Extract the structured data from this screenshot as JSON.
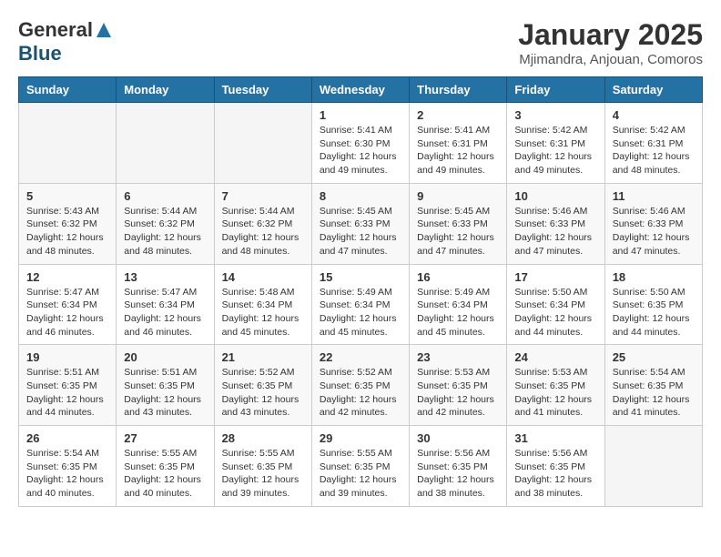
{
  "header": {
    "logo_general": "General",
    "logo_blue": "Blue",
    "month_title": "January 2025",
    "subtitle": "Mjimandra, Anjouan, Comoros"
  },
  "weekdays": [
    "Sunday",
    "Monday",
    "Tuesday",
    "Wednesday",
    "Thursday",
    "Friday",
    "Saturday"
  ],
  "weeks": [
    [
      {
        "day": "",
        "info": ""
      },
      {
        "day": "",
        "info": ""
      },
      {
        "day": "",
        "info": ""
      },
      {
        "day": "1",
        "info": "Sunrise: 5:41 AM\nSunset: 6:30 PM\nDaylight: 12 hours\nand 49 minutes."
      },
      {
        "day": "2",
        "info": "Sunrise: 5:41 AM\nSunset: 6:31 PM\nDaylight: 12 hours\nand 49 minutes."
      },
      {
        "day": "3",
        "info": "Sunrise: 5:42 AM\nSunset: 6:31 PM\nDaylight: 12 hours\nand 49 minutes."
      },
      {
        "day": "4",
        "info": "Sunrise: 5:42 AM\nSunset: 6:31 PM\nDaylight: 12 hours\nand 48 minutes."
      }
    ],
    [
      {
        "day": "5",
        "info": "Sunrise: 5:43 AM\nSunset: 6:32 PM\nDaylight: 12 hours\nand 48 minutes."
      },
      {
        "day": "6",
        "info": "Sunrise: 5:44 AM\nSunset: 6:32 PM\nDaylight: 12 hours\nand 48 minutes."
      },
      {
        "day": "7",
        "info": "Sunrise: 5:44 AM\nSunset: 6:32 PM\nDaylight: 12 hours\nand 48 minutes."
      },
      {
        "day": "8",
        "info": "Sunrise: 5:45 AM\nSunset: 6:33 PM\nDaylight: 12 hours\nand 47 minutes."
      },
      {
        "day": "9",
        "info": "Sunrise: 5:45 AM\nSunset: 6:33 PM\nDaylight: 12 hours\nand 47 minutes."
      },
      {
        "day": "10",
        "info": "Sunrise: 5:46 AM\nSunset: 6:33 PM\nDaylight: 12 hours\nand 47 minutes."
      },
      {
        "day": "11",
        "info": "Sunrise: 5:46 AM\nSunset: 6:33 PM\nDaylight: 12 hours\nand 47 minutes."
      }
    ],
    [
      {
        "day": "12",
        "info": "Sunrise: 5:47 AM\nSunset: 6:34 PM\nDaylight: 12 hours\nand 46 minutes."
      },
      {
        "day": "13",
        "info": "Sunrise: 5:47 AM\nSunset: 6:34 PM\nDaylight: 12 hours\nand 46 minutes."
      },
      {
        "day": "14",
        "info": "Sunrise: 5:48 AM\nSunset: 6:34 PM\nDaylight: 12 hours\nand 45 minutes."
      },
      {
        "day": "15",
        "info": "Sunrise: 5:49 AM\nSunset: 6:34 PM\nDaylight: 12 hours\nand 45 minutes."
      },
      {
        "day": "16",
        "info": "Sunrise: 5:49 AM\nSunset: 6:34 PM\nDaylight: 12 hours\nand 45 minutes."
      },
      {
        "day": "17",
        "info": "Sunrise: 5:50 AM\nSunset: 6:34 PM\nDaylight: 12 hours\nand 44 minutes."
      },
      {
        "day": "18",
        "info": "Sunrise: 5:50 AM\nSunset: 6:35 PM\nDaylight: 12 hours\nand 44 minutes."
      }
    ],
    [
      {
        "day": "19",
        "info": "Sunrise: 5:51 AM\nSunset: 6:35 PM\nDaylight: 12 hours\nand 44 minutes."
      },
      {
        "day": "20",
        "info": "Sunrise: 5:51 AM\nSunset: 6:35 PM\nDaylight: 12 hours\nand 43 minutes."
      },
      {
        "day": "21",
        "info": "Sunrise: 5:52 AM\nSunset: 6:35 PM\nDaylight: 12 hours\nand 43 minutes."
      },
      {
        "day": "22",
        "info": "Sunrise: 5:52 AM\nSunset: 6:35 PM\nDaylight: 12 hours\nand 42 minutes."
      },
      {
        "day": "23",
        "info": "Sunrise: 5:53 AM\nSunset: 6:35 PM\nDaylight: 12 hours\nand 42 minutes."
      },
      {
        "day": "24",
        "info": "Sunrise: 5:53 AM\nSunset: 6:35 PM\nDaylight: 12 hours\nand 41 minutes."
      },
      {
        "day": "25",
        "info": "Sunrise: 5:54 AM\nSunset: 6:35 PM\nDaylight: 12 hours\nand 41 minutes."
      }
    ],
    [
      {
        "day": "26",
        "info": "Sunrise: 5:54 AM\nSunset: 6:35 PM\nDaylight: 12 hours\nand 40 minutes."
      },
      {
        "day": "27",
        "info": "Sunrise: 5:55 AM\nSunset: 6:35 PM\nDaylight: 12 hours\nand 40 minutes."
      },
      {
        "day": "28",
        "info": "Sunrise: 5:55 AM\nSunset: 6:35 PM\nDaylight: 12 hours\nand 39 minutes."
      },
      {
        "day": "29",
        "info": "Sunrise: 5:55 AM\nSunset: 6:35 PM\nDaylight: 12 hours\nand 39 minutes."
      },
      {
        "day": "30",
        "info": "Sunrise: 5:56 AM\nSunset: 6:35 PM\nDaylight: 12 hours\nand 38 minutes."
      },
      {
        "day": "31",
        "info": "Sunrise: 5:56 AM\nSunset: 6:35 PM\nDaylight: 12 hours\nand 38 minutes."
      },
      {
        "day": "",
        "info": ""
      }
    ]
  ]
}
